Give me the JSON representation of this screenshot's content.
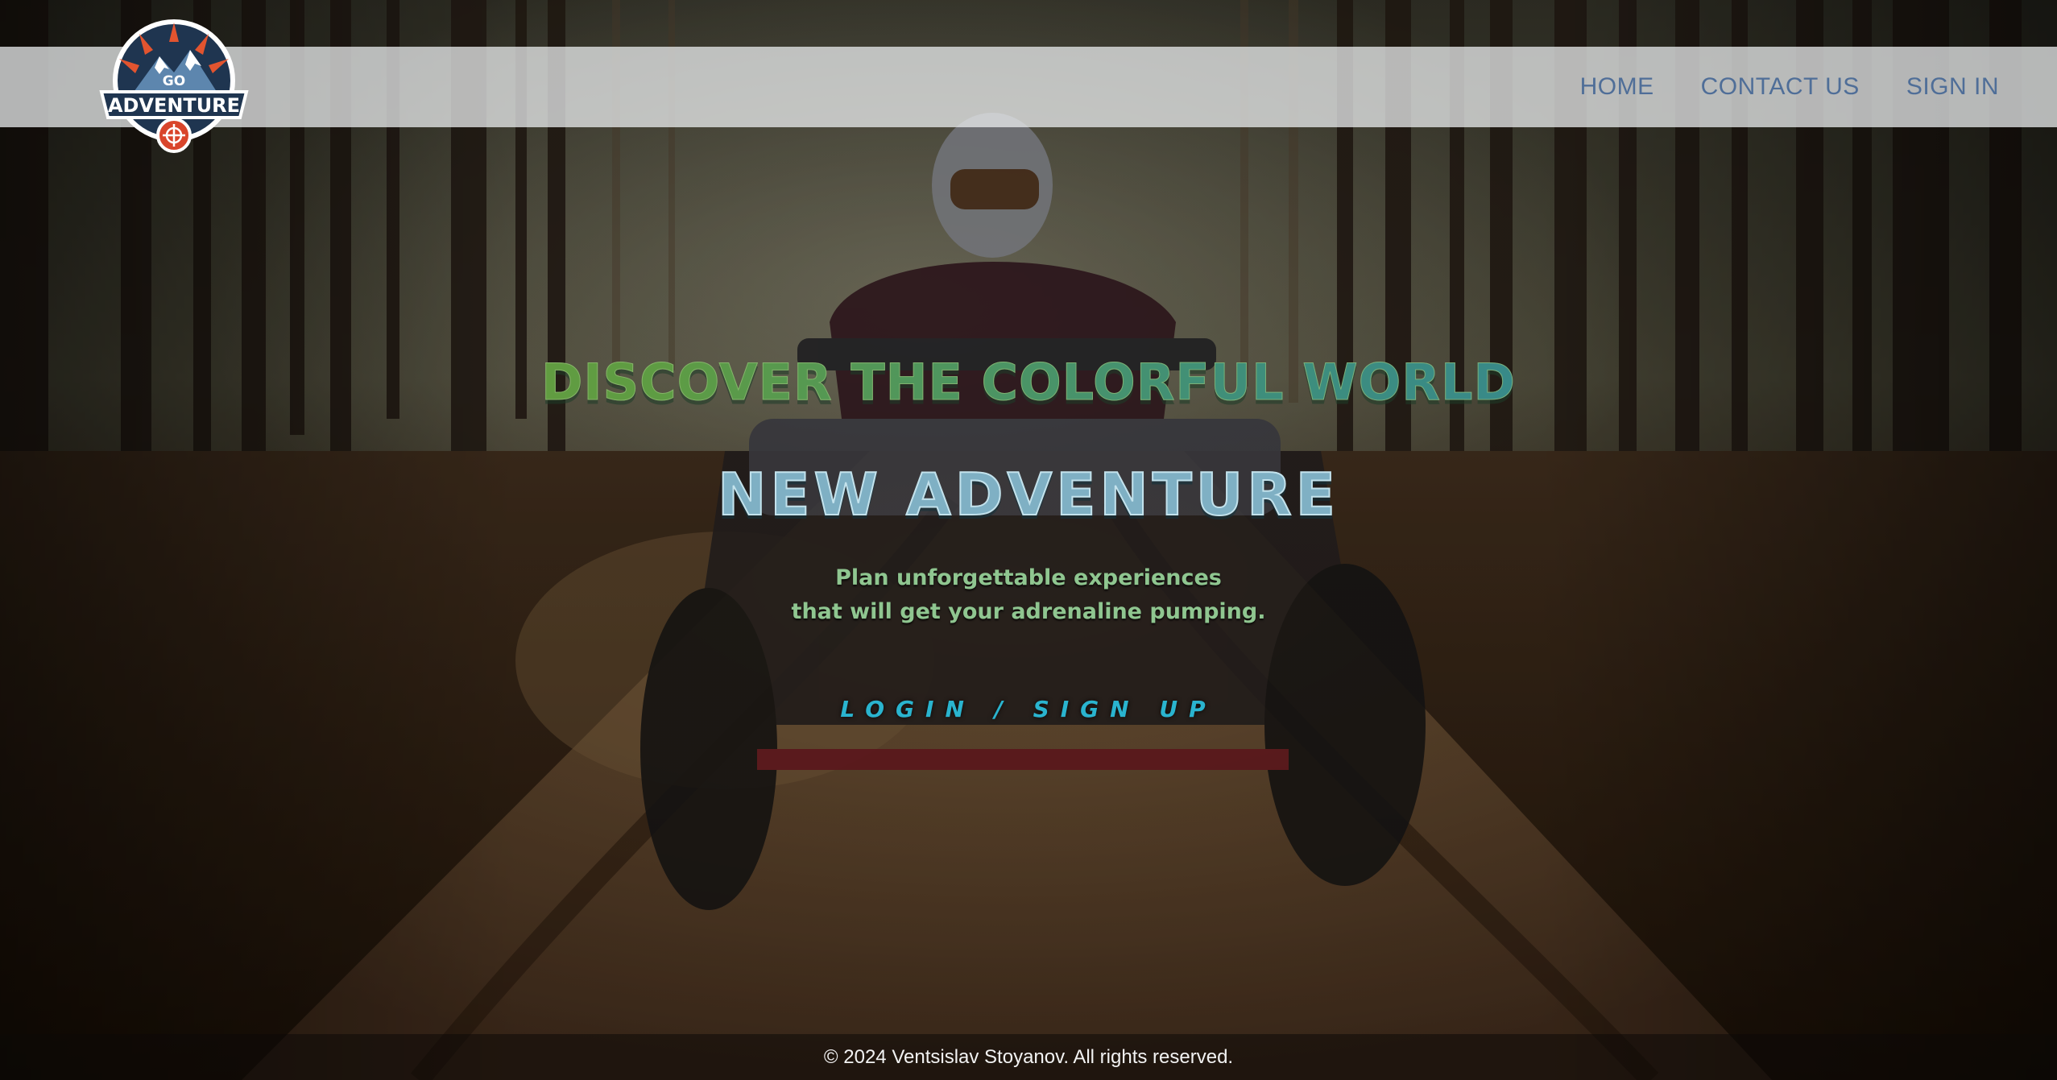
{
  "brand": {
    "logo_small_text": "GO",
    "logo_text": "ADVENTURE"
  },
  "nav": {
    "items": [
      {
        "label": "HOME"
      },
      {
        "label": "CONTACT US"
      },
      {
        "label": "SIGN IN"
      }
    ]
  },
  "hero": {
    "headline": "DISCOVER THE COLORFUL WORLD",
    "subheadline": "NEW ADVENTURE",
    "tagline_line1": "Plan unforgettable experiences",
    "tagline_line2": "that will get your adrenaline pumping.",
    "cta_label": "LOGIN / SIGN UP"
  },
  "footer": {
    "copyright": "© 2024 Ventsislav Stoyanov. All rights reserved."
  },
  "colors": {
    "nav_link": "#4f6e98",
    "headline_start": "#6f9a37",
    "headline_end": "#2b7fa6",
    "subheadline": "#7fb0c4",
    "tagline": "#8fc690",
    "cta": "#2ab4cf"
  }
}
